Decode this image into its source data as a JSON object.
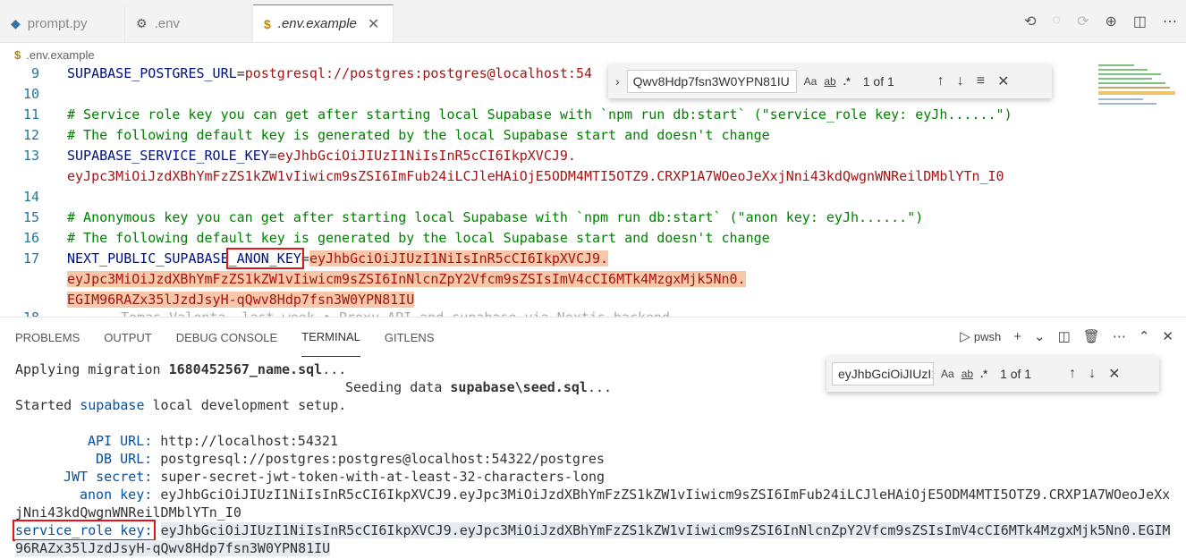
{
  "tabs": [
    {
      "label": "prompt.py",
      "icon": "python-file-icon"
    },
    {
      "label": ".env",
      "icon": "gear-icon"
    },
    {
      "label": ".env.example",
      "icon": "dollar-icon",
      "active": true
    }
  ],
  "breadcrumb": {
    "file": ".env.example"
  },
  "editor": {
    "lines": [
      {
        "num": "9",
        "key": "SUPABASE_POSTGRES_URL",
        "eq": "=",
        "val": "postgresql://postgres:postgres@localhost:54"
      },
      {
        "num": "10"
      },
      {
        "num": "11",
        "comment": "# Service role key you can get after starting local Supabase with `npm run db:start` (\"service_role key: eyJh......\")"
      },
      {
        "num": "12",
        "comment": "# The following default key is generated by the local Supabase start and doesn't change"
      },
      {
        "num": "13",
        "key": "SUPABASE_SERVICE_ROLE_KEY",
        "eq": "=",
        "val": "eyJhbGciOiJIUzI1NiIsInR5cCI6IkpXVCJ9."
      },
      {
        "num": "",
        "val": "eyJpc3MiOiJzdXBhYmFzZS1kZW1vIiwicm9sZSI6ImFub24iLCJleHAiOjE5ODM4MTI5OTZ9.CRXP1A7WOeoJeXxjNni43kdQwgnWNReilDMblYTn_I0"
      },
      {
        "num": "14"
      },
      {
        "num": "15",
        "comment": "# Anonymous key you can get after starting local Supabase with `npm run db:start` (\"anon key: eyJh......\")"
      },
      {
        "num": "16",
        "comment": "# The following default key is generated by the local Supabase start and doesn't change"
      },
      {
        "num": "17",
        "key_a": "NEXT_PUBLIC_SUPABASE",
        "key_b": "_ANON_KEY",
        "eq": "=",
        "val": "eyJhbGciOiJIUzI1NiIsInR5cCI6IkpXVCJ9."
      },
      {
        "num": "",
        "val": "eyJpc3MiOiJzdXBhYmFzZS1kZW1vIiwicm9sZSI6InNlcnZpY2Vfcm9sZSIsImV4cCI6MTk4MzgxMjk5Nn0."
      },
      {
        "num": "",
        "val": "EGIM96RAZx35lJzdJsyH-qQwv8Hdp7fsn3W0YPN81IU"
      },
      {
        "num": "18",
        "blame": "Tomas Valenta, last week • Proxy API and supabase via Nextjs backend"
      }
    ],
    "find": {
      "query": "Qwv8Hdp7fsn3W0YPN81IU",
      "match_case": "Aa",
      "whole_word": "ab",
      "regex": ".*",
      "count": "1 of 1"
    }
  },
  "panel": {
    "tabs": [
      "PROBLEMS",
      "OUTPUT",
      "DEBUG CONSOLE",
      "TERMINAL",
      "GITLENS"
    ],
    "active_tab": "TERMINAL",
    "shell": "pwsh"
  },
  "terminal": {
    "l1_pre": "Applying migration ",
    "l1_bold": "1680452567_name.sql",
    "l1_post": "...",
    "l2_pre": "Seeding data ",
    "l2_bold": "supabase\\seed.sql",
    "l2_post": "...",
    "l3_pre": "Started ",
    "l3_blue": "supabase",
    "l3_post": " local development setup.",
    "api_label": "API URL:",
    "api_val": "http://localhost:54321",
    "db_label": "DB URL:",
    "db_val": "postgresql://postgres:postgres@localhost:54322/postgres",
    "jwt_label": "JWT secret:",
    "jwt_val": "super-secret-jwt-token-with-at-least-32-characters-long",
    "anon_label": "anon key:",
    "anon_val1": "eyJhbGciOiJIUzI1NiIsInR5cCI6IkpXVCJ9.eyJpc3MiOiJzdXBhYmFzZS1kZW1vIiwicm9sZSI6ImFub24iLCJleHAiOjE5ODM4MTI5OTZ9.CRXP1A7WOeoJeXx",
    "anon_val2": "jNni43kdQwgnWNReilDMblYTn_I0",
    "svc_label": "service_role key:",
    "svc_val1": "eyJhbGciOiJIUzI1NiIsInR5cCI6IkpXVCJ9.eyJpc3MiOiJzdXBhYmFzZS1kZW1vIiwicm9sZSI6InNlcnZpY2Vfcm9sZSIsImV4cCI6MTk4MzgxMjk5Nn0.EGIM",
    "svc_val2": "96RAZx35lJzdJsyH-qQwv8Hdp7fsn3W0YPN81IU",
    "find": {
      "query": "eyJhbGciOiJIUzI1",
      "match_case": "Aa",
      "whole_word": "ab",
      "regex": ".*",
      "count": "1 of 1"
    }
  }
}
